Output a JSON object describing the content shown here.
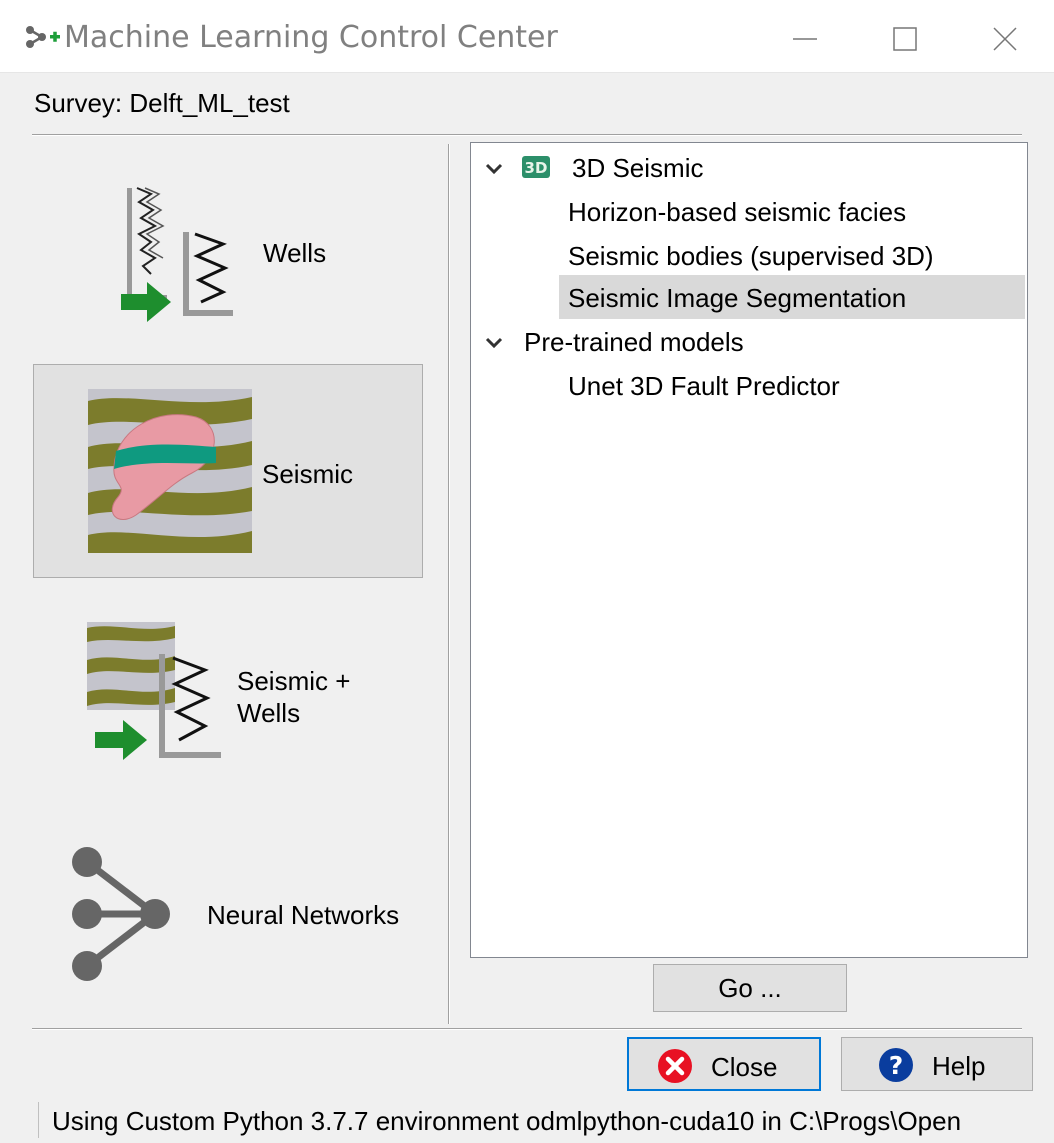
{
  "window": {
    "title": "Machine Learning Control Center",
    "icon": "network-plus-icon",
    "controls": [
      "minimize-icon",
      "maximize-icon",
      "close-icon"
    ]
  },
  "survey": {
    "label": "Survey: Delft_ML_test"
  },
  "categories": [
    {
      "label": "Wells",
      "icon": "wells-log-icon",
      "selected": false
    },
    {
      "label": "Seismic",
      "icon": "seismic-body-icon",
      "selected": true
    },
    {
      "label_line1": "Seismic +",
      "label_line2": "Wells",
      "icon": "seismic-wells-icon",
      "selected": false
    },
    {
      "label": "Neural Networks",
      "icon": "neural-network-icon",
      "selected": false
    }
  ],
  "tree": {
    "groups": [
      {
        "label": "3D Seismic",
        "icon": "3d-cube-icon",
        "icon_text": "3D",
        "expanded": true,
        "items": [
          {
            "label": "Horizon-based seismic facies"
          },
          {
            "label": "Seismic bodies (supervised 3D)"
          },
          {
            "label": "Seismic Image Segmentation",
            "selected": true
          }
        ]
      },
      {
        "label": "Pre-trained models",
        "expanded": true,
        "items": [
          {
            "label": "Unet 3D Fault Predictor"
          }
        ]
      }
    ]
  },
  "buttons": {
    "go": "Go ...",
    "close": "Close",
    "help": "Help"
  },
  "colors": {
    "selection": "#d9d9d9",
    "focus_border": "#0078d7",
    "close_icon": "#e81123",
    "help_icon": "#0a3d9e",
    "arrow_green": "#1e8e2e"
  },
  "status": {
    "text": "Using Custom Python 3.7.7 environment odmlpython-cuda10 in C:\\Progs\\Open"
  }
}
